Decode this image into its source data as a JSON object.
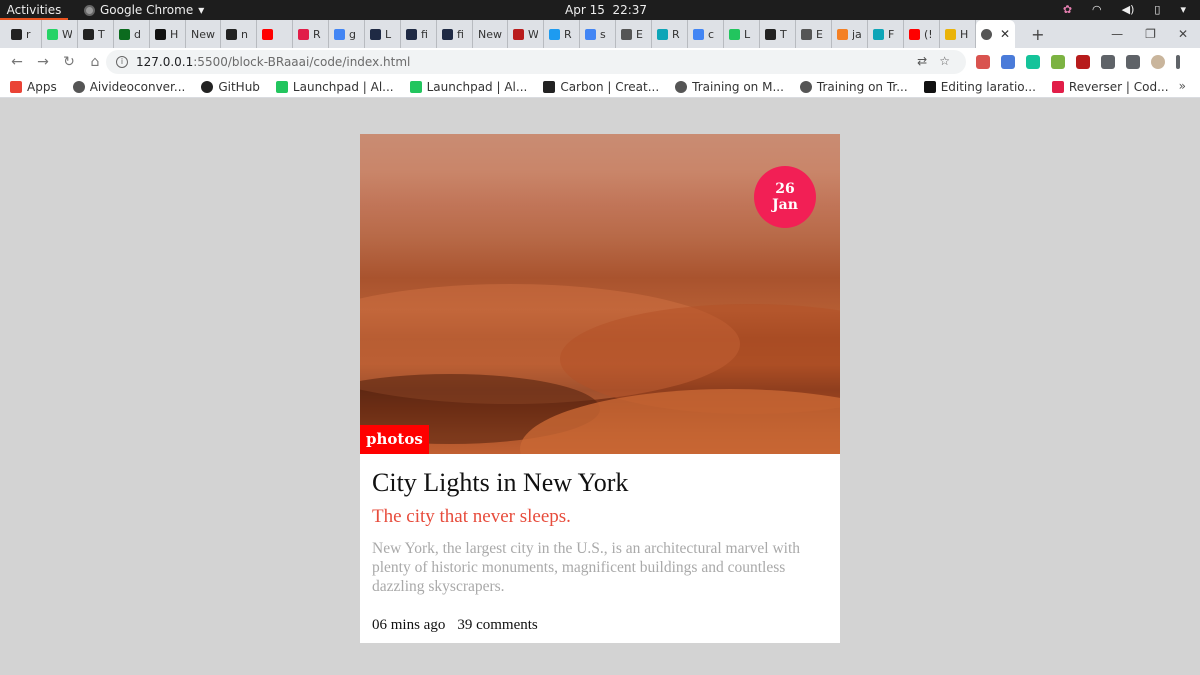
{
  "system_bar": {
    "activities": "Activities",
    "app_name": "Google Chrome",
    "app_menu_arrow": "▾",
    "date": "Apr 15",
    "time": "22:37",
    "icons": [
      "settings-flower-icon",
      "wifi-icon",
      "volume-icon",
      "battery-icon",
      "power-menu-icon"
    ]
  },
  "tabs": [
    {
      "label": "r",
      "icon": "github-icon",
      "color": "#222222"
    },
    {
      "label": "W",
      "icon": "whatsapp-icon",
      "color": "#25d366"
    },
    {
      "label": "T",
      "icon": "github-icon",
      "color": "#222222"
    },
    {
      "label": "d",
      "icon": "terminal-icon",
      "color": "#0b6b1e"
    },
    {
      "label": "H",
      "icon": "dev-icon",
      "color": "#111111"
    },
    {
      "label": "New",
      "icon": "",
      "color": ""
    },
    {
      "label": "n",
      "icon": "github-icon",
      "color": "#222222"
    },
    {
      "label": "",
      "icon": "youtube-icon",
      "color": "#ff0000"
    },
    {
      "label": "R",
      "icon": "link-icon",
      "color": "#e11d48"
    },
    {
      "label": "g",
      "icon": "google-icon",
      "color": "#4285f4"
    },
    {
      "label": "L",
      "icon": "dark-a-icon",
      "color": "#1f2a44"
    },
    {
      "label": "fi",
      "icon": "dark-a-icon",
      "color": "#1f2a44"
    },
    {
      "label": "fi",
      "icon": "dark-a-icon",
      "color": "#1f2a44"
    },
    {
      "label": "New",
      "icon": "",
      "color": ""
    },
    {
      "label": "W",
      "icon": "flag-icon",
      "color": "#b91c1c"
    },
    {
      "label": "R",
      "icon": "twitter-icon",
      "color": "#1d9bf0"
    },
    {
      "label": "s",
      "icon": "google-icon",
      "color": "#4285f4"
    },
    {
      "label": "E",
      "icon": "globe-icon",
      "color": "#555555"
    },
    {
      "label": "R",
      "icon": "react-icon",
      "color": "#0ea5b7"
    },
    {
      "label": "c",
      "icon": "google-icon",
      "color": "#4285f4"
    },
    {
      "label": "L",
      "icon": "chart-icon",
      "color": "#22c55e"
    },
    {
      "label": "T",
      "icon": "github-icon",
      "color": "#222222"
    },
    {
      "label": "E",
      "icon": "globe-icon",
      "color": "#555555"
    },
    {
      "label": "ja",
      "icon": "stack-icon",
      "color": "#f48024"
    },
    {
      "label": "F",
      "icon": "react-icon",
      "color": "#0ea5b7"
    },
    {
      "label": "(!",
      "icon": "youtube-icon",
      "color": "#ff0000"
    },
    {
      "label": "H",
      "icon": "emoji-icon",
      "color": "#eab308"
    }
  ],
  "active_tab": {
    "icon": "globe-icon",
    "close": "✕"
  },
  "new_tab": "+",
  "window_controls": [
    "—",
    "❐",
    "✕"
  ],
  "address_bar": {
    "host": "127.0.0.1",
    "path": ":5500/block-BRaaai/code/index.html"
  },
  "extensions": [
    {
      "icon": "ext-red-icon",
      "color": "#d9534f"
    },
    {
      "icon": "translate-icon",
      "color": "#4a7bd9"
    },
    {
      "icon": "grammarly-icon",
      "color": "#15c39a"
    },
    {
      "icon": "color-wheel-icon",
      "color": "#7cb342"
    },
    {
      "icon": "ublock-icon",
      "color": "#b71c1c"
    },
    {
      "icon": "puzzle-icon",
      "color": "#5f6368"
    },
    {
      "icon": "reading-list-icon",
      "color": "#5f6368"
    },
    {
      "icon": "profile-avatar-icon",
      "color": "#c9b59c"
    },
    {
      "icon": "menu-dots-icon",
      "color": "#5f6368"
    }
  ],
  "bookmarks": [
    {
      "label": "Apps",
      "icon": "apps-grid-icon",
      "color": "#ea4335"
    },
    {
      "label": "Aivideoconver...",
      "icon": "globe-icon",
      "color": "#555555"
    },
    {
      "label": "GitHub",
      "icon": "github-icon",
      "color": "#222222"
    },
    {
      "label": "Launchpad | Al...",
      "icon": "chart-icon",
      "color": "#22c55e"
    },
    {
      "label": "Launchpad | Al...",
      "icon": "chart-icon",
      "color": "#22c55e"
    },
    {
      "label": "Carbon | Creat...",
      "icon": "carbon-icon",
      "color": "#222222"
    },
    {
      "label": "Training on M...",
      "icon": "globe-icon",
      "color": "#555555"
    },
    {
      "label": "Training on Tr...",
      "icon": "globe-icon",
      "color": "#555555"
    },
    {
      "label": "Editing laratio...",
      "icon": "medium-icon",
      "color": "#111111"
    },
    {
      "label": "Reverser | Cod...",
      "icon": "reverser-icon",
      "color": "#e11d48"
    }
  ],
  "bookmarks_more": "»",
  "card": {
    "date_day": "26",
    "date_month": "Jan",
    "category": "photos",
    "title": "City Lights in New York",
    "subtitle": "The city that never sleeps.",
    "description": "New York, the largest city in the U.S., is an architectural marvel with plenty of historic monuments, magnificent buildings and countless dazzling skyscrapers.",
    "time_ago": "06 mins ago",
    "comments": "39 comments"
  }
}
